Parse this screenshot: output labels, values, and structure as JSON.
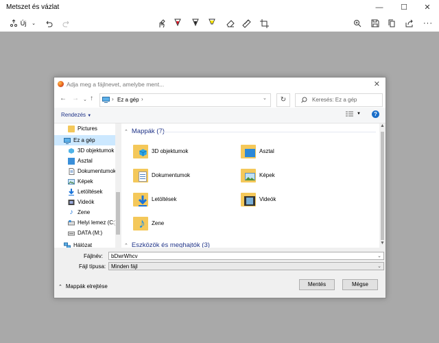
{
  "app": {
    "title": "Metszet és vázlat",
    "new_label": "Új"
  },
  "dialog": {
    "title": "Adja meg a fájlnevet, amelybe ment...",
    "breadcrumb": "Ez a gép",
    "search_placeholder": "Keresés: Ez a gép",
    "organize_label": "Rendezés",
    "nav_items": [
      {
        "label": "Pictures",
        "icon": "folder-icon"
      },
      {
        "label": "Ez a gép",
        "icon": "computer-icon"
      },
      {
        "label": "3D objektumok",
        "icon": "3d-objects-icon"
      },
      {
        "label": "Asztal",
        "icon": "desktop-icon"
      },
      {
        "label": "Dokumentumok",
        "icon": "documents-icon"
      },
      {
        "label": "Képek",
        "icon": "pictures-icon"
      },
      {
        "label": "Letöltések",
        "icon": "downloads-icon"
      },
      {
        "label": "Videók",
        "icon": "videos-icon"
      },
      {
        "label": "Zene",
        "icon": "music-icon"
      },
      {
        "label": "Helyi lemez (C:)",
        "icon": "drive-icon"
      },
      {
        "label": "DATA (M:)",
        "icon": "drive-icon"
      },
      {
        "label": "Hálózat",
        "icon": "network-icon"
      }
    ],
    "folders_header": "Mappák (7)",
    "folders": [
      {
        "label": "3D objektumok",
        "icon": "3d-objects-folder-icon"
      },
      {
        "label": "Asztal",
        "icon": "desktop-folder-icon"
      },
      {
        "label": "Dokumentumok",
        "icon": "documents-folder-icon"
      },
      {
        "label": "Képek",
        "icon": "pictures-folder-icon"
      },
      {
        "label": "Letöltések",
        "icon": "downloads-folder-icon"
      },
      {
        "label": "Videók",
        "icon": "videos-folder-icon"
      },
      {
        "label": "Zene",
        "icon": "music-folder-icon"
      }
    ],
    "drives_header": "Eszközök és meghajtók (3)",
    "filename_label": "Fájlnév:",
    "filename_value": "bDwrWhcv",
    "filetype_label": "Fájl típusa:",
    "filetype_value": "Minden fájl",
    "hide_folders_label": "Mappák elrejtése",
    "save_label": "Mentés",
    "cancel_label": "Mégse"
  },
  "colors": {
    "canvas_bg": "#a9a9a9",
    "selected_nav": "#cce8ff",
    "section_blue": "#1e3287",
    "folder_yellow": "#f4c85a"
  }
}
